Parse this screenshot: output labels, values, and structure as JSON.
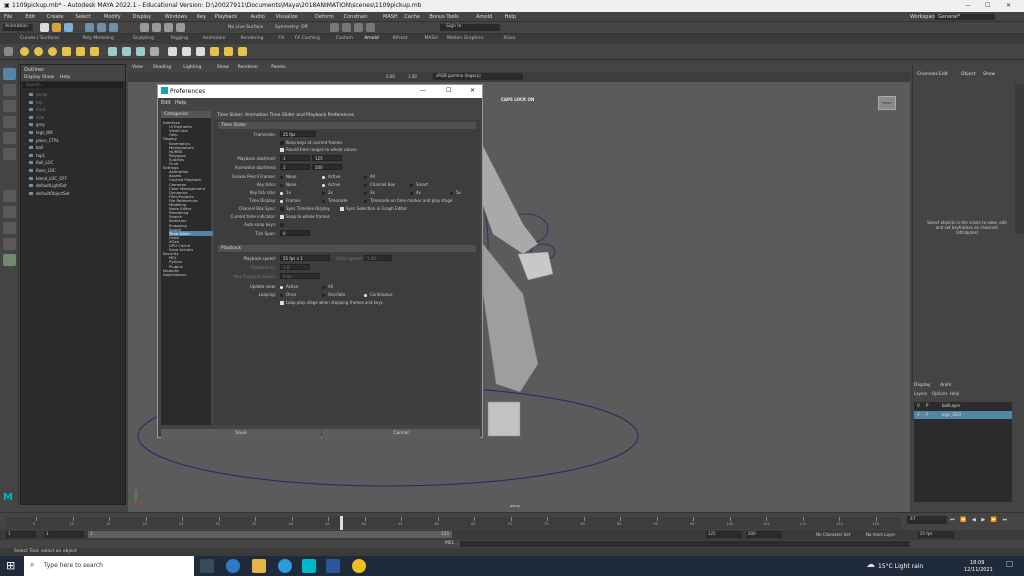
{
  "window": {
    "title": "1109pickup.mb* - Autodesk MAYA 2022.1 - Educational Version: D:\\20027911\\Documents\\Maya\\2018ANIMATION\\scenes\\1109pickup.mb",
    "minimize": "—",
    "maximize": "☐",
    "close": "✕",
    "workspace_label": "Workspace:",
    "workspace_value": "General*"
  },
  "menubar": [
    "File",
    "Edit",
    "Create",
    "Select",
    "Modify",
    "Display",
    "Windows",
    "Key",
    "Playback",
    "Audio",
    "Visualize",
    "Deform",
    "Constrain",
    "MASH",
    "Cache",
    "Bonus Tools",
    "Arnold",
    "Help"
  ],
  "statusline": {
    "mode": "Animation",
    "live_surface": "No Live Surface",
    "symmetry": "Symmetry: Off",
    "sign_in": "Sign In"
  },
  "shelf_tabs": [
    "Curves / Surfaces",
    "Poly Modeling",
    "Sculpting",
    "Rigging",
    "Animation",
    "Rendering",
    "FX",
    "FX Caching",
    "Custom",
    "Arnold",
    "Bifrost",
    "MASH",
    "Motion Graphics",
    "XGen"
  ],
  "outliner": {
    "title": "Outliner",
    "menu": [
      "Display",
      "Show",
      "Help"
    ],
    "search_placeholder": "Search...",
    "items": [
      "persp",
      "top",
      "front",
      "side",
      "grey",
      "legs_IKR",
      "place_CTRL",
      "ball",
      "top1",
      "Ball_LOC",
      "Base_LOC",
      "blend_LOC_OFF",
      "defaultLightSet",
      "defaultObjectSet"
    ]
  },
  "viewport": {
    "menu": [
      "View",
      "Shading",
      "Lighting",
      "Show",
      "Renderer",
      "Panels"
    ],
    "caps_lock": "CAPS LOCK ON",
    "camera_label": "persp",
    "view_cube": "FRONT",
    "colorspace": "sRGB gamma (legacy)",
    "exposure": "0.00",
    "gamma": "1.00"
  },
  "channel_box": {
    "menu": [
      "Channels",
      "Edit",
      "Object",
      "Show"
    ],
    "hint": "Select objects in the scene to view, edit and set keyframes on channels (attributes)"
  },
  "layer_editor": {
    "tabs": [
      "Display",
      "Anim"
    ],
    "menu": [
      "Layers",
      "Options",
      "Help"
    ],
    "layers": [
      {
        "v": "V",
        "p": "P",
        "name": "ballLayer"
      },
      {
        "v": "V",
        "p": "P",
        "name": "legs_GEO"
      }
    ]
  },
  "preferences": {
    "title": "Preferences",
    "menu": [
      "Edit",
      "Help"
    ],
    "categories_header": "Categories",
    "categories": [
      {
        "label": "Interface",
        "indent": 0
      },
      {
        "label": "UI Elements",
        "indent": 1
      },
      {
        "label": "ViewCube",
        "indent": 1
      },
      {
        "label": "Help",
        "indent": 1
      },
      {
        "label": "Display",
        "indent": 0
      },
      {
        "label": "Kinematics",
        "indent": 1
      },
      {
        "label": "Manipulators",
        "indent": 1
      },
      {
        "label": "NURBS",
        "indent": 1
      },
      {
        "label": "Polygons",
        "indent": 1
      },
      {
        "label": "Subdivs",
        "indent": 1
      },
      {
        "label": "Fluid",
        "indent": 1
      },
      {
        "label": "Settings",
        "indent": 0
      },
      {
        "label": "Animation",
        "indent": 1
      },
      {
        "label": "Assets",
        "indent": 1
      },
      {
        "label": "Cached Playback",
        "indent": 1
      },
      {
        "label": "Cameras",
        "indent": 1
      },
      {
        "label": "Color Management",
        "indent": 1
      },
      {
        "label": "Dynamics",
        "indent": 1
      },
      {
        "label": "Files/Projects",
        "indent": 1
      },
      {
        "label": "File References",
        "indent": 1
      },
      {
        "label": "Modeling",
        "indent": 1
      },
      {
        "label": "Node Editor",
        "indent": 1
      },
      {
        "label": "Rendering",
        "indent": 1
      },
      {
        "label": "Search",
        "indent": 1
      },
      {
        "label": "Selection",
        "indent": 1
      },
      {
        "label": "Snapping",
        "indent": 1
      },
      {
        "label": "Sound",
        "indent": 1
      },
      {
        "label": "Time Slider",
        "indent": 1,
        "selected": true
      },
      {
        "label": "Undo",
        "indent": 1
      },
      {
        "label": "XGen",
        "indent": 1
      },
      {
        "label": "GPU Cache",
        "indent": 1
      },
      {
        "label": "Save Actions",
        "indent": 1
      },
      {
        "label": "Security",
        "indent": 0
      },
      {
        "label": "MEL",
        "indent": 1
      },
      {
        "label": "Python",
        "indent": 1
      },
      {
        "label": "Plugins",
        "indent": 1
      },
      {
        "label": "Modules",
        "indent": 0
      },
      {
        "label": "Applications",
        "indent": 0
      }
    ],
    "content_header": "Time Slider: Animation Time Slider and Playback Preferences",
    "time_slider_section": "Time Slider",
    "framerate_label": "Framerate:",
    "framerate_value": "25 fps",
    "keep_keys": "Keep keys at current frames",
    "round_time": "Round time ranges to whole values",
    "playback_start_end_label": "Playback start/end:",
    "playback_start": "1",
    "playback_end": "125",
    "anim_start_end_label": "Animation start/end:",
    "anim_start": "1",
    "anim_end": "200",
    "grease_label": "Grease Pencil Frames:",
    "grease_opts": [
      "None",
      "Active",
      "All"
    ],
    "key_ticks_label": "Key ticks:",
    "key_ticks_opts": [
      "None",
      "Active",
      "Channel Box",
      "Smart"
    ],
    "key_tick_size_label": "Key tick size:",
    "key_tick_size_opts": [
      "1x",
      "2x",
      "3x",
      "4x",
      "5x"
    ],
    "time_display_label": "Time Display:",
    "time_display_opts": [
      "Frames",
      "Timecode",
      "Timecode on time marker and play stage"
    ],
    "channel_box_sync_label": "Channel Box Sync:",
    "sync_timeline": "Sync Timeline Display",
    "sync_selection": "Sync Selection in Graph Editor",
    "current_time_label": "Current time indicator:",
    "snap_whole": "Snap to whole frames",
    "auto_snap_label": "Auto snap keys:",
    "tick_span_label": "Tick Span:",
    "tick_span_value": "0",
    "playback_section": "Playback",
    "playback_speed_label": "Playback speed:",
    "playback_speed_value": "25 fps x 1",
    "other_speed_label": "Other speed:",
    "other_speed_value": "1.00",
    "playback_by_label": "Playback by:",
    "playback_by_value": "1.0",
    "max_speed_label": "Max Playback Speed:",
    "max_speed_value": "Free",
    "update_view_label": "Update view:",
    "update_view_opts": [
      "Active",
      "All"
    ],
    "looping_label": "Looping:",
    "looping_opts": [
      "Once",
      "Oscillate",
      "Continuous"
    ],
    "loop_play_stage": "Loop play stage when stepping frames and keys",
    "save_button": "Save",
    "cancel_button": "Cancel"
  },
  "timeline": {
    "ticks": [
      "5",
      "10",
      "15",
      "20",
      "25",
      "30",
      "35",
      "40",
      "45",
      "50",
      "55",
      "60",
      "65",
      "70",
      "75",
      "80",
      "85",
      "90",
      "95",
      "100",
      "105",
      "110",
      "115",
      "120"
    ],
    "current_frame": "47",
    "range_start": "1",
    "range_start2": "1",
    "range_inner_start": "1",
    "range_inner_end": "125",
    "range_end": "125",
    "anim_end": "200",
    "fps": "25 fps",
    "no_character": "No Character Set",
    "no_anim_layer": "No Anim Layer"
  },
  "cmdline": {
    "label": "MEL"
  },
  "helpline": {
    "text": "Select Tool: select an object"
  },
  "taskbar": {
    "search_placeholder": "Type here to search",
    "weather": "15°C  Light rain",
    "time": "18:09",
    "date": "12/11/2021"
  },
  "colors": {
    "selection_blue": "#5285a6",
    "maya_teal": "#00b8c8"
  }
}
